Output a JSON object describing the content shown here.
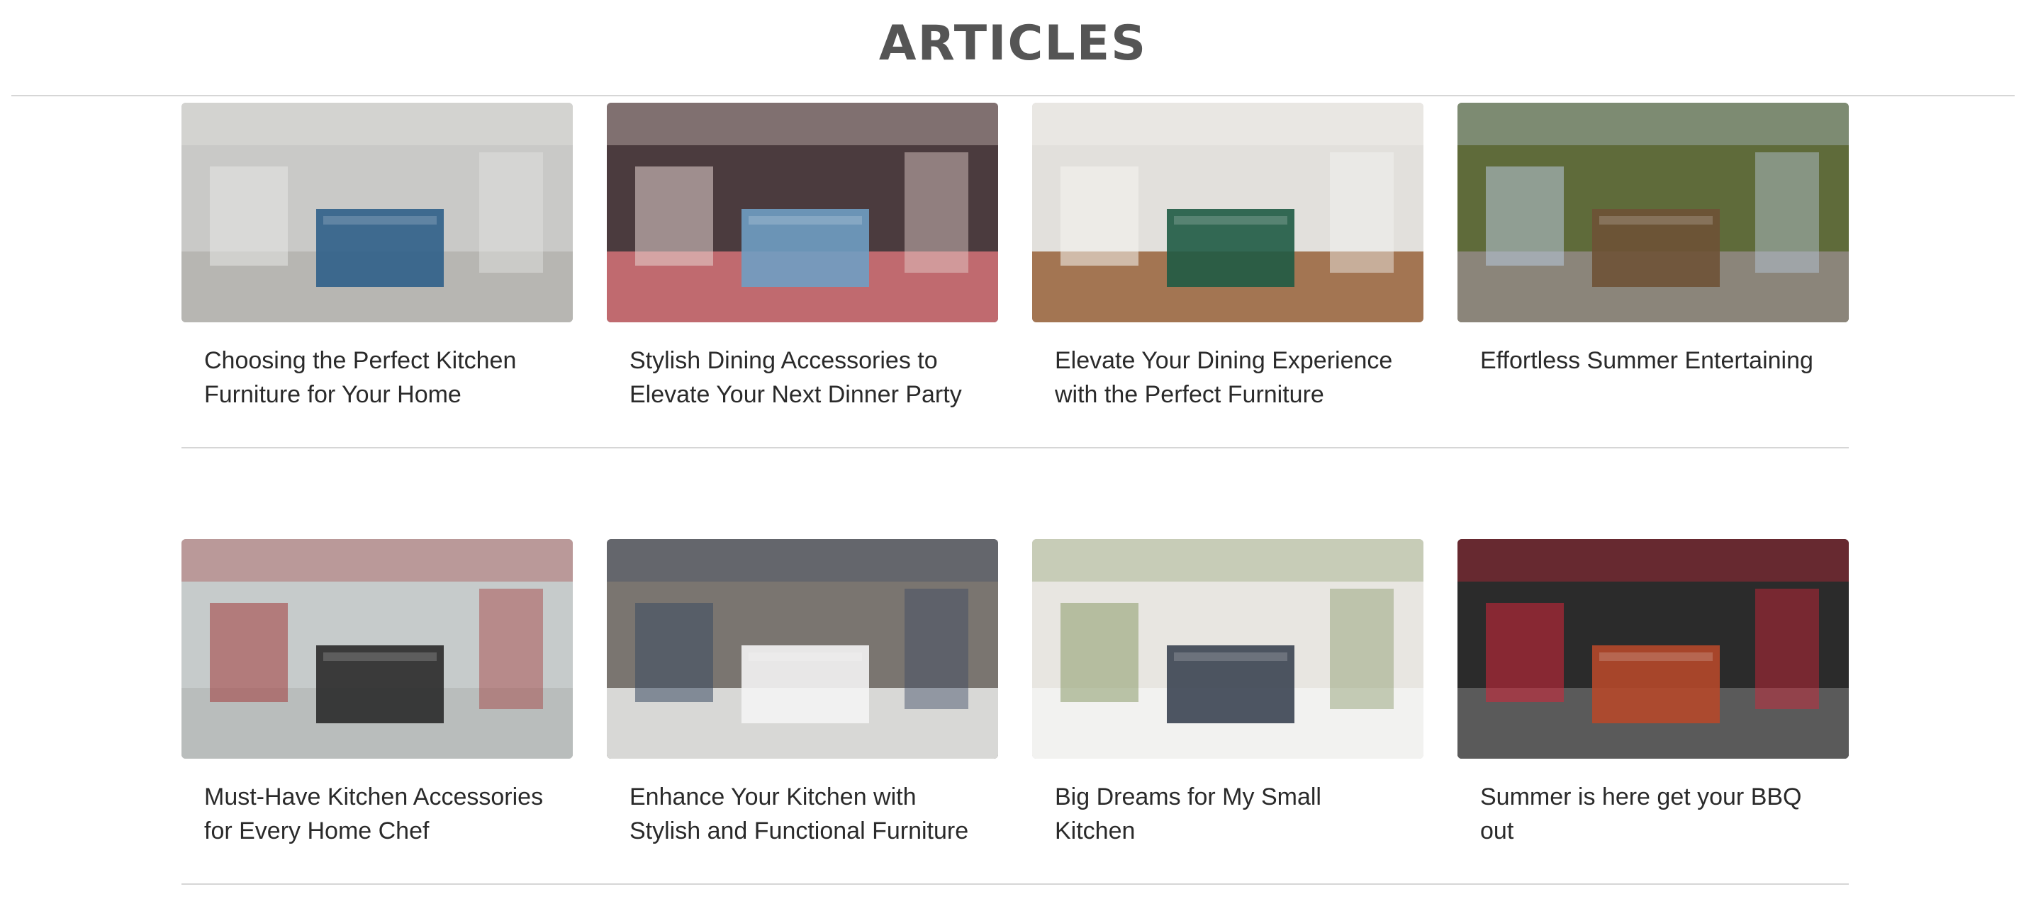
{
  "header": {
    "title": "ARTICLES"
  },
  "articles": [
    {
      "title": "Choosing the Perfect Kitchen Furniture for Your Home",
      "image": "kitchen-island-photo",
      "colors": {
        "bg": "#c9c9c7",
        "floor": "#b7b6b2",
        "accent": "#2f5f88",
        "detail": "#e5e5e3"
      }
    },
    {
      "title": "Stylish Dining Accessories to Elevate Your Next Dinner Party",
      "image": "dining-table-setting-photo",
      "colors": {
        "bg": "#4b3b3e",
        "floor": "#c06a6f",
        "accent": "#6f9fc3",
        "detail": "#e6d3cf"
      }
    },
    {
      "title": "Elevate Your Dining Experience with the Perfect Furniture",
      "image": "dining-room-green-chairs-photo",
      "colors": {
        "bg": "#e2e0dc",
        "floor": "#a37552",
        "accent": "#1f5b44",
        "detail": "#f5f4f1"
      }
    },
    {
      "title": "Effortless Summer Entertaining",
      "image": "outdoor-patio-dining-photo",
      "colors": {
        "bg": "#5f6b3a",
        "floor": "#8b857a",
        "accent": "#6e5236",
        "detail": "#b8c9dd"
      }
    },
    {
      "title": "Must-Have Kitchen Accessories for Every Home Chef",
      "image": "cookware-set-photo",
      "colors": {
        "bg": "#c6cbcb",
        "floor": "#b9bdbc",
        "accent": "#2a2a2a",
        "detail": "#a33b3b"
      }
    },
    {
      "title": "Enhance Your Kitchen with Stylish and Functional Furniture",
      "image": "pull-out-pantry-photo",
      "colors": {
        "bg": "#7a7570",
        "floor": "#d8d8d6",
        "accent": "#f4f4f4",
        "detail": "#3b4a63"
      }
    },
    {
      "title": "Big Dreams for My Small Kitchen",
      "image": "white-kitchen-window-photo",
      "colors": {
        "bg": "#e8e6e1",
        "floor": "#f2f2f0",
        "accent": "#3b4452",
        "detail": "#8a9a6a"
      }
    },
    {
      "title": "Summer is here get your BBQ out",
      "image": "bbq-ribs-grill-photo",
      "colors": {
        "bg": "#2b2b2b",
        "floor": "#5a5a5a",
        "accent": "#b5482a",
        "detail": "#d6263a"
      }
    }
  ]
}
